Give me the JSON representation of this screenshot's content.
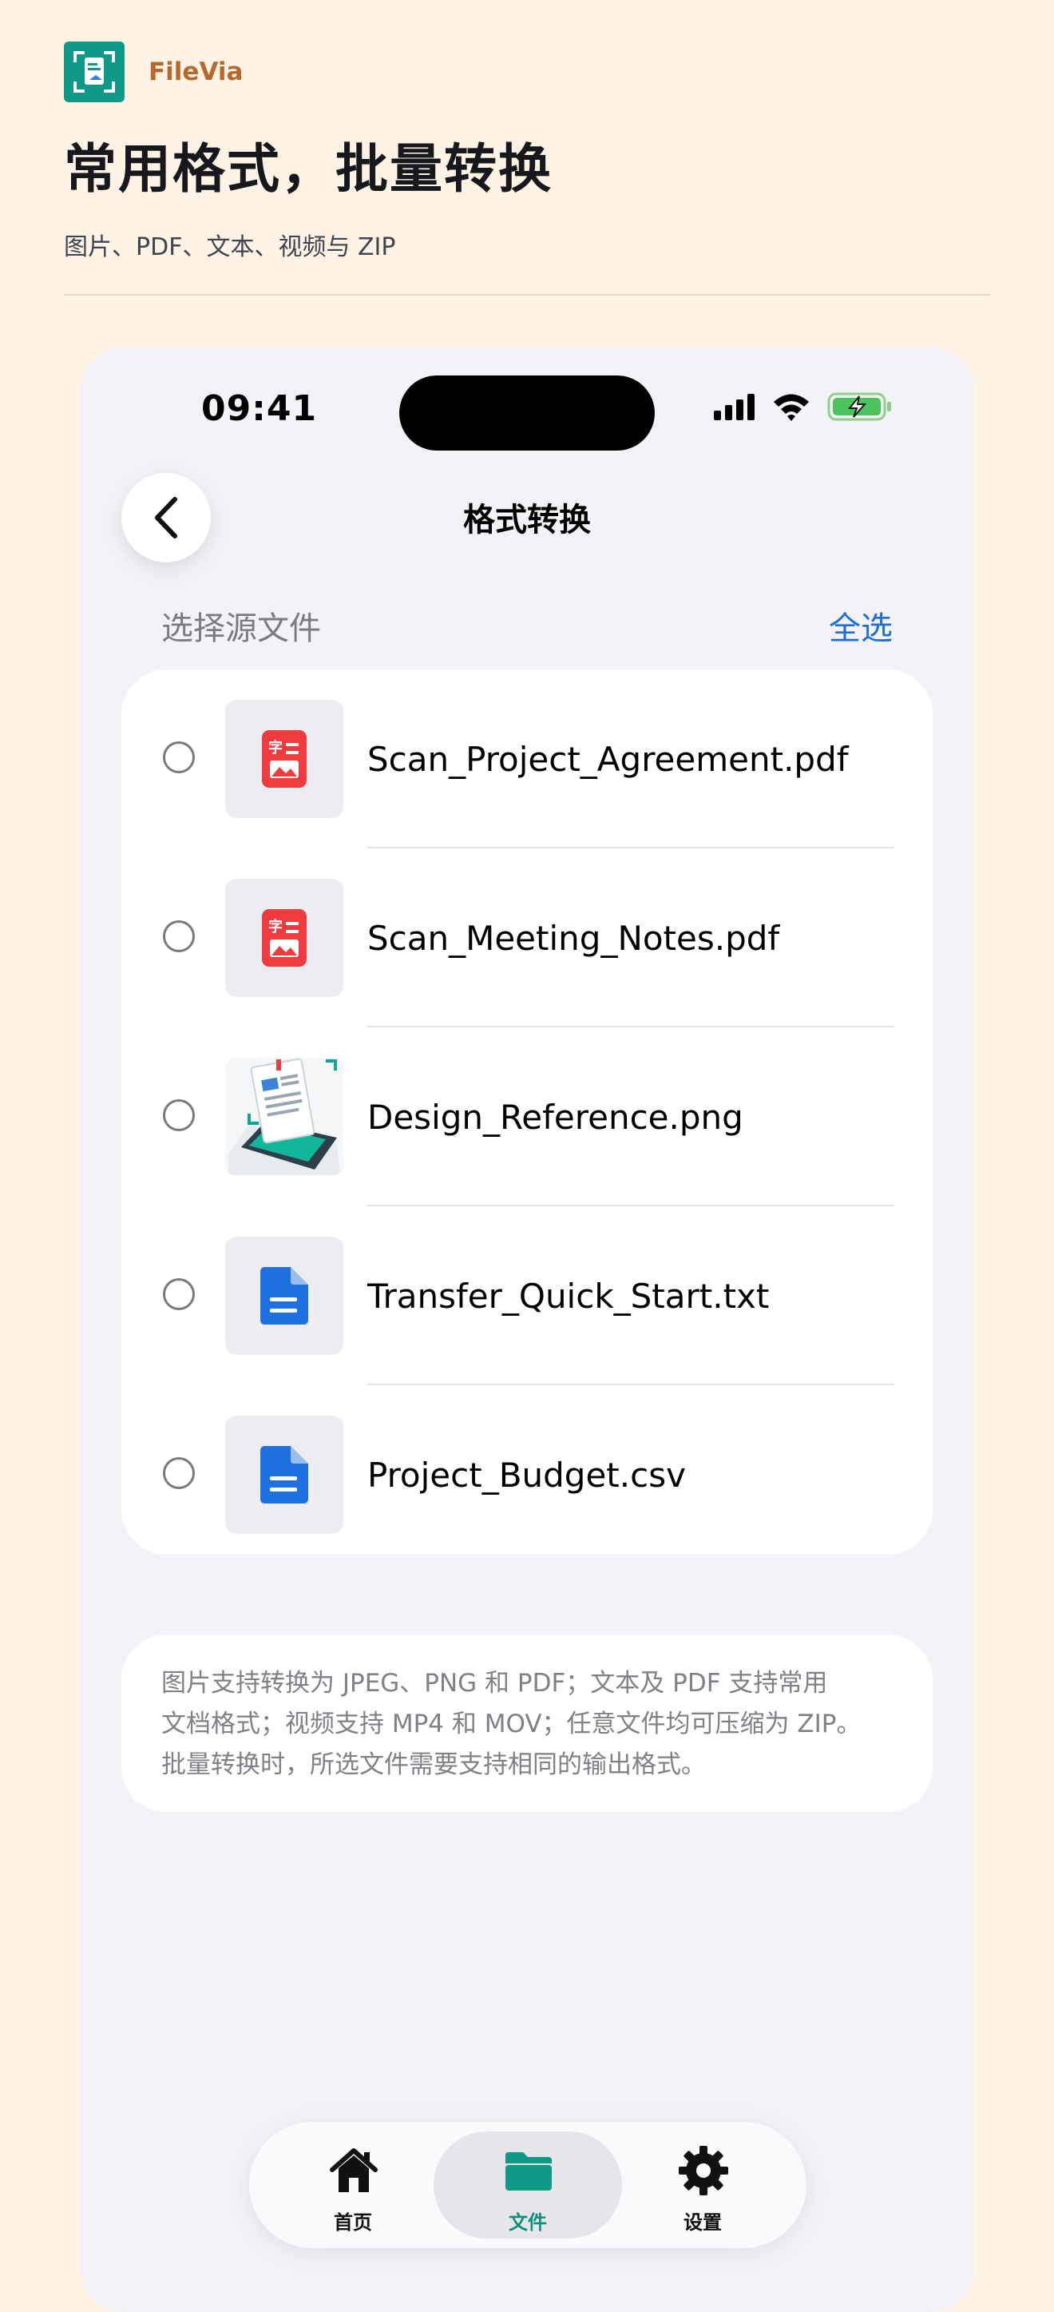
{
  "brand": {
    "name": "FileVia"
  },
  "headline": "常用格式，批量转换",
  "subline": "图片、PDF、文本、视频与 ZIP",
  "status_bar": {
    "time": "09:41"
  },
  "nav": {
    "title": "格式转换"
  },
  "section": {
    "label": "选择源文件",
    "select_all": "全选"
  },
  "files": [
    {
      "name": "Scan_Project_Agreement.pdf",
      "icon": "pdf-scan-icon"
    },
    {
      "name": "Scan_Meeting_Notes.pdf",
      "icon": "pdf-scan-icon"
    },
    {
      "name": "Design_Reference.png",
      "icon": "image-thumbnail"
    },
    {
      "name": "Transfer_Quick_Start.txt",
      "icon": "document-icon"
    },
    {
      "name": "Project_Budget.csv",
      "icon": "document-icon"
    }
  ],
  "info": {
    "lines": [
      "图片支持转换为 JPEG、PNG 和 PDF；文本及 PDF 支持常用",
      "文档格式；视频支持 MP4 和 MOV；任意文件均可压缩为 ZIP。",
      "批量转换时，所选文件需要支持相同的输出格式。"
    ]
  },
  "tabs": [
    {
      "label": "首页",
      "icon": "home-icon"
    },
    {
      "label": "文件",
      "icon": "folder-icon",
      "active": true
    },
    {
      "label": "设置",
      "icon": "gear-icon"
    }
  ],
  "colors": {
    "accent": "#0E9A86",
    "link": "#1F6FD6",
    "pdf_red": "#F03A3E",
    "doc_blue": "#1E6FE0",
    "background": "#FEF3E5"
  }
}
